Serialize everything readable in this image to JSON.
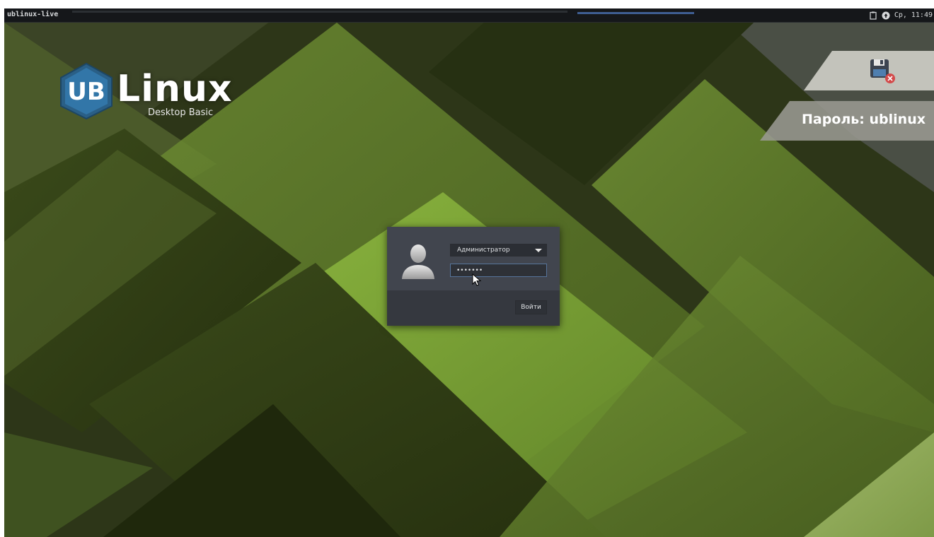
{
  "topbar": {
    "hostname": "ublinux-live",
    "clock": "Ср, 11:49",
    "tray_icons": [
      "clipboard-icon",
      "network-icon"
    ]
  },
  "branding": {
    "logo_text": "Linux",
    "logo_mark": "UB",
    "logo_subtitle": "Desktop Basic"
  },
  "hint": {
    "password_text": "Пароль: ublinux",
    "save_icon": "floppy-disk-icon"
  },
  "login": {
    "user_selected": "Администратор",
    "password_mask": "•••••••",
    "submit_label": "Войти"
  },
  "colors": {
    "green_light": "#7fa83a",
    "green_dark": "#2c3a12",
    "panel": "#3b3f47",
    "focus": "#56749a"
  }
}
